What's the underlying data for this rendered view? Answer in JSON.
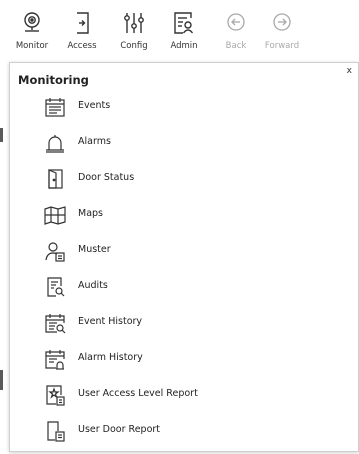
{
  "toolbar": {
    "buttons": [
      {
        "label": "Monitor",
        "icon": "monitor-icon"
      },
      {
        "label": "Access",
        "icon": "access-icon"
      },
      {
        "label": "Config",
        "icon": "config-icon"
      },
      {
        "label": "Admin",
        "icon": "admin-icon"
      },
      {
        "label": "Back",
        "icon": "back-icon",
        "disabled": true
      },
      {
        "label": "Forward",
        "icon": "forward-icon",
        "disabled": true
      }
    ]
  },
  "panel": {
    "title": "Monitoring",
    "close_label": "x",
    "items": [
      {
        "label": "Events",
        "icon": "events-icon"
      },
      {
        "label": "Alarms",
        "icon": "alarm-bell-icon"
      },
      {
        "label": "Door Status",
        "icon": "door-icon"
      },
      {
        "label": "Maps",
        "icon": "map-icon"
      },
      {
        "label": "Muster",
        "icon": "muster-icon"
      },
      {
        "label": "Audits",
        "icon": "audit-icon"
      },
      {
        "label": "Event History",
        "icon": "event-history-icon"
      },
      {
        "label": "Alarm History",
        "icon": "alarm-history-icon"
      },
      {
        "label": "User Access Level Report",
        "icon": "user-access-report-icon"
      },
      {
        "label": "User Door Report",
        "icon": "user-door-report-icon"
      }
    ]
  },
  "colors": {
    "icon_stroke": "#333333",
    "disabled": "#a8a8a8",
    "panel_border": "#cfcfcf"
  }
}
